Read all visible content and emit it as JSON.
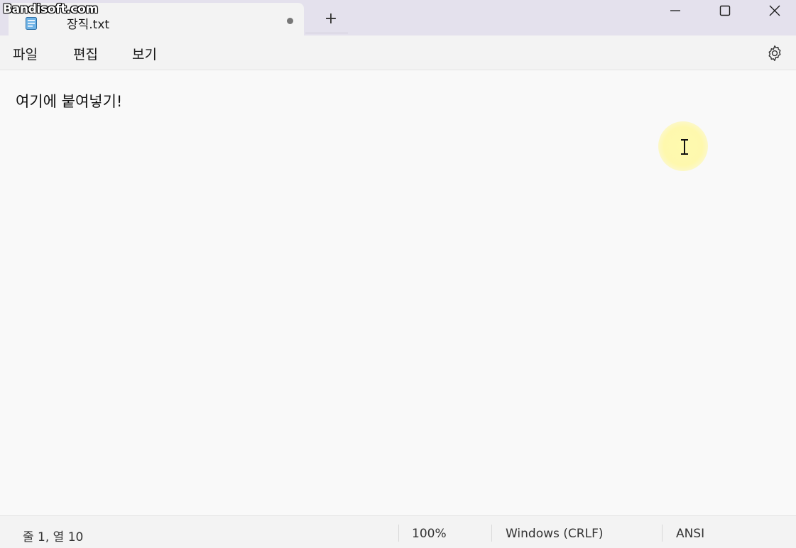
{
  "watermark": {
    "text": "Bandisoft.com"
  },
  "tab": {
    "title": "장직.txt",
    "unsaved": true,
    "file_icon": "notepad-icon"
  },
  "titlebar": {
    "new_tab_label": "+",
    "minimize_icon": "minimize-icon",
    "maximize_icon": "maximize-icon",
    "close_icon": "close-icon"
  },
  "menu": {
    "items": [
      {
        "label": "파일"
      },
      {
        "label": "편집"
      },
      {
        "label": "보기"
      }
    ],
    "settings_icon": "gear-icon"
  },
  "editor": {
    "content": "여기에 붙여넣기!"
  },
  "status": {
    "position": "줄 1, 열 10",
    "zoom": "100%",
    "line_ending": "Windows (CRLF)",
    "encoding": "ANSI"
  },
  "colors": {
    "titlebar_bg": "#e4e1ed",
    "tab_bg": "#f3f3f3",
    "editor_bg": "#f9f9f9",
    "cursor_highlight": "#fff8a0"
  }
}
